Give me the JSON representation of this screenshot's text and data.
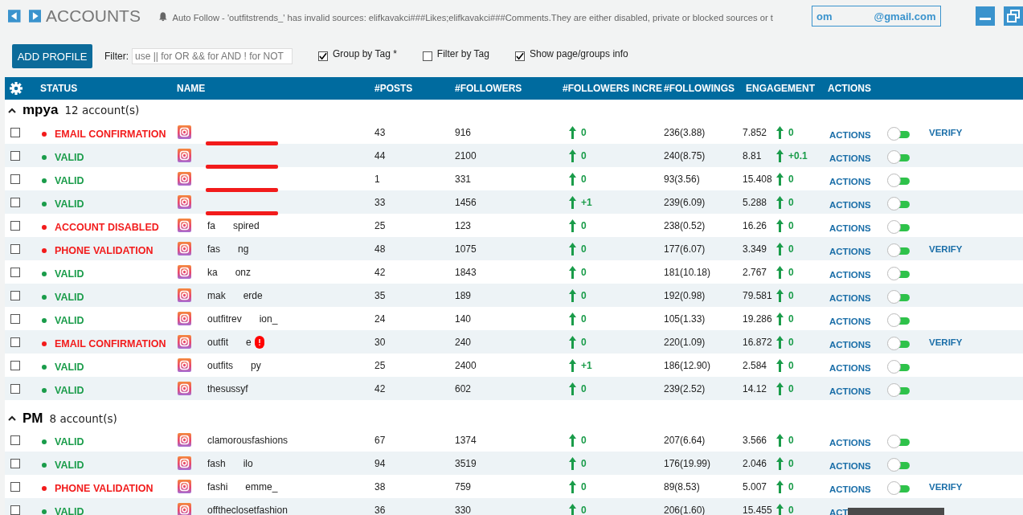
{
  "topbar": {
    "title": "ACCOUNTS",
    "notification": "Auto Follow - 'outfitstrends_' has invalid sources: elifkavakci###Likes;elifkavakci###Comments.They are either disabled, private or blocked sources or t",
    "account": {
      "parts": [
        "om",
        "@gmail.com"
      ]
    }
  },
  "toolbar": {
    "button": "ADD PROFILE",
    "filter_label": "Filter:",
    "filter_placeholder": "use || for OR && for AND ! for NOT",
    "options": [
      {
        "label": "Group by Tag *",
        "checked": true
      },
      {
        "label": "Filter by Tag",
        "checked": false
      },
      {
        "label": "Show page/groups info",
        "checked": true
      }
    ]
  },
  "table": {
    "columns": [
      "STATUS",
      "NAME",
      "#POSTS",
      "#FOLLOWERS",
      "#FOLLOWERS INCRE",
      "#FOLLOWINGS",
      "ENGAGEMENT",
      "ACTIONS"
    ],
    "groups": [
      {
        "name": "mpya",
        "count": "12 account(s)",
        "expanded": true,
        "rows": [
          {
            "checked": false,
            "status": "EMAIL CONFIRMATION",
            "color": "#f21b1b",
            "redacted": true,
            "name_parts": [],
            "alert": false,
            "posts": "43",
            "followers": "916",
            "followers_increase": "0",
            "followings": "236(3.88)",
            "engagement": "7.852",
            "engagement_change": "0",
            "actions": "ACTIONS",
            "on": false,
            "verify": "VERIFY"
          },
          {
            "checked": false,
            "status": "VALID",
            "color": "#1a9c4a",
            "redacted": true,
            "name_parts": [],
            "alert": false,
            "posts": "44",
            "followers": "2100",
            "followers_increase": "0",
            "followings": "240(8.75)",
            "engagement": "8.81",
            "engagement_change": "+0.1",
            "actions": "ACTIONS",
            "on": false
          },
          {
            "checked": false,
            "status": "VALID",
            "color": "#1a9c4a",
            "redacted": true,
            "name_parts": [],
            "alert": false,
            "posts": "1",
            "followers": "331",
            "followers_increase": "0",
            "followings": "93(3.56)",
            "engagement": "15.408",
            "engagement_change": "0",
            "actions": "ACTIONS",
            "on": false
          },
          {
            "checked": false,
            "status": "VALID",
            "color": "#1a9c4a",
            "redacted": true,
            "name_parts": [],
            "alert": false,
            "posts": "33",
            "followers": "1456",
            "followers_increase": "+1",
            "followings": "239(6.09)",
            "engagement": "5.288",
            "engagement_change": "0",
            "actions": "ACTIONS",
            "on": false
          },
          {
            "checked": false,
            "status": "ACCOUNT DISABLED",
            "color": "#f21b1b",
            "redacted": false,
            "name_parts": [
              "fa",
              "spired"
            ],
            "alert": false,
            "posts": "25",
            "followers": "123",
            "followers_increase": "0",
            "followings": "238(0.52)",
            "engagement": "16.26",
            "engagement_change": "0",
            "actions": "ACTIONS",
            "on": false
          },
          {
            "checked": false,
            "status": "PHONE VALIDATION",
            "color": "#f21b1b",
            "redacted": false,
            "name_parts": [
              "fas",
              "ng"
            ],
            "alert": false,
            "posts": "48",
            "followers": "1075",
            "followers_increase": "0",
            "followings": "177(6.07)",
            "engagement": "3.349",
            "engagement_change": "0",
            "actions": "ACTIONS",
            "on": false,
            "verify": "VERIFY"
          },
          {
            "checked": false,
            "status": "VALID",
            "color": "#1a9c4a",
            "redacted": false,
            "name_parts": [
              "ka",
              "onz"
            ],
            "alert": false,
            "posts": "42",
            "followers": "1843",
            "followers_increase": "0",
            "followings": "181(10.18)",
            "engagement": "2.767",
            "engagement_change": "0",
            "actions": "ACTIONS",
            "on": false
          },
          {
            "checked": false,
            "status": "VALID",
            "color": "#1a9c4a",
            "redacted": false,
            "name_parts": [
              "mak",
              "erde"
            ],
            "alert": false,
            "posts": "35",
            "followers": "189",
            "followers_increase": "0",
            "followings": "192(0.98)",
            "engagement": "79.581",
            "engagement_change": "0",
            "actions": "ACTIONS",
            "on": false
          },
          {
            "checked": false,
            "status": "VALID",
            "color": "#1a9c4a",
            "redacted": false,
            "name_parts": [
              "outfitrev",
              "ion_"
            ],
            "alert": false,
            "posts": "24",
            "followers": "140",
            "followers_increase": "0",
            "followings": "105(1.33)",
            "engagement": "19.286",
            "engagement_change": "0",
            "actions": "ACTIONS",
            "on": false
          },
          {
            "checked": false,
            "status": "EMAIL CONFIRMATION",
            "color": "#f21b1b",
            "redacted": false,
            "name_parts": [
              "outfit",
              "e"
            ],
            "alert": true,
            "posts": "30",
            "followers": "240",
            "followers_increase": "0",
            "followings": "220(1.09)",
            "engagement": "16.872",
            "engagement_change": "0",
            "actions": "ACTIONS",
            "on": false,
            "verify": "VERIFY"
          },
          {
            "checked": false,
            "status": "VALID",
            "color": "#1a9c4a",
            "redacted": false,
            "name_parts": [
              "outfits",
              "py"
            ],
            "alert": false,
            "posts": "25",
            "followers": "2400",
            "followers_increase": "+1",
            "followings": "186(12.90)",
            "engagement": "2.584",
            "engagement_change": "0",
            "actions": "ACTIONS",
            "on": false
          },
          {
            "checked": false,
            "status": "VALID",
            "color": "#1a9c4a",
            "redacted": false,
            "name_parts": [
              "thesussyf"
            ],
            "alert": false,
            "posts": "42",
            "followers": "602",
            "followers_increase": "0",
            "followings": "239(2.52)",
            "engagement": "14.12",
            "engagement_change": "0",
            "actions": "ACTIONS",
            "on": false
          }
        ]
      },
      {
        "name": "PM",
        "count": "8 account(s)",
        "expanded": true,
        "rows": [
          {
            "checked": false,
            "status": "VALID",
            "color": "#1a9c4a",
            "redacted": false,
            "name_parts": [
              "clamorousfashions"
            ],
            "alert": false,
            "posts": "67",
            "followers": "1374",
            "followers_increase": "0",
            "followings": "207(6.64)",
            "engagement": "3.566",
            "engagement_change": "0",
            "actions": "ACTIONS",
            "on": false
          },
          {
            "checked": false,
            "status": "VALID",
            "color": "#1a9c4a",
            "redacted": false,
            "name_parts": [
              "fash",
              "ilo"
            ],
            "alert": false,
            "posts": "94",
            "followers": "3519",
            "followers_increase": "0",
            "followings": "176(19.99)",
            "engagement": "2.046",
            "engagement_change": "0",
            "actions": "ACTIONS",
            "on": false
          },
          {
            "checked": false,
            "status": "PHONE VALIDATION",
            "color": "#f21b1b",
            "redacted": false,
            "name_parts": [
              "fashi",
              "emme_"
            ],
            "alert": false,
            "posts": "38",
            "followers": "759",
            "followers_increase": "0",
            "followings": "89(8.53)",
            "engagement": "5.007",
            "engagement_change": "0",
            "actions": "ACTIONS",
            "on": false,
            "verify": "VERIFY"
          },
          {
            "checked": false,
            "status": "VALID",
            "color": "#1a9c4a",
            "redacted": false,
            "name_parts": [
              "offtheclosetfashion"
            ],
            "alert": false,
            "posts": "36",
            "followers": "330",
            "followers_increase": "0",
            "followings": "206(1.60)",
            "engagement": "15.455",
            "engagement_change": "0",
            "actions": "ACT"
          }
        ]
      }
    ]
  },
  "tooltip": {
    "kind": "dark"
  }
}
